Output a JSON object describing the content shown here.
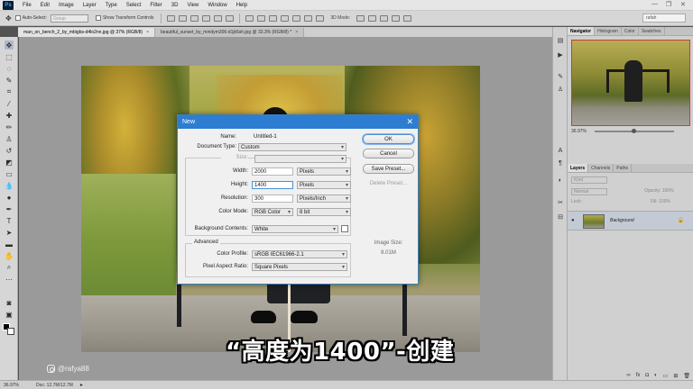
{
  "app": {
    "logo": "Ps",
    "menu": [
      "File",
      "Edit",
      "Image",
      "Layer",
      "Type",
      "Select",
      "Filter",
      "3D",
      "View",
      "Window",
      "Help"
    ],
    "window_controls": [
      "—",
      "❐",
      "✕"
    ]
  },
  "options_bar": {
    "auto_select_label": "Auto-Select:",
    "auto_select_value": "Group",
    "show_transform_label": "Show Transform Controls",
    "mode_3d_label": "3D Mode:",
    "search_value": "rafah"
  },
  "tabs": [
    {
      "label": "man_on_bench_2_by_mbigbs-d4lo2nn.jpg @ 37% (RGB/8)",
      "close": "×"
    },
    {
      "label": "beautiful_sunset_by_mindym306-d1jk6sh.jpg @ 33.3% (RGB/8) *",
      "close": "×"
    }
  ],
  "dialog": {
    "title": "New",
    "close": "✕",
    "name_label": "Name:",
    "name_value": "Untitled-1",
    "doc_type_label": "Document Type:",
    "doc_type_value": "Custom",
    "size_label": "Size:",
    "width_label": "Width:",
    "width_value": "2000",
    "width_unit": "Pixels",
    "height_label": "Height:",
    "height_value": "1400",
    "height_unit": "Pixels",
    "resolution_label": "Resolution:",
    "resolution_value": "300",
    "resolution_unit": "Pixels/Inch",
    "color_mode_label": "Color Mode:",
    "color_mode_value": "RGB Color",
    "bit_depth_value": "8 bit",
    "bg_contents_label": "Background Contents:",
    "bg_contents_value": "White",
    "advanced_label": "Advanced",
    "color_profile_label": "Color Profile:",
    "color_profile_value": "sRGB IEC61966-2.1",
    "pixel_aspect_label": "Pixel Aspect Ratio:",
    "pixel_aspect_value": "Square Pixels",
    "buttons": {
      "ok": "OK",
      "cancel": "Cancel",
      "save_preset": "Save Preset...",
      "delete_preset": "Delete Preset..."
    },
    "image_size_label": "Image Size:",
    "image_size_value": "8.01M"
  },
  "subtitle": "“高度为1400”-创建",
  "watermark": "@rafya88",
  "status_bar": {
    "zoom": "36.97%",
    "doc": "Doc: 12.7M/12.7M",
    "arrow": "▸"
  },
  "panels": {
    "top_tabs": [
      "Navigator",
      "Histogram",
      "Color",
      "Swatches"
    ],
    "navigator_zoom": "36.97%",
    "layer_tabs": [
      "Layers",
      "Channels",
      "Paths"
    ],
    "layer_kind": "Kind",
    "layer_blend": "Normal",
    "layer_opacity": "Opacity: 100%",
    "layer_fill": "Fill: 100%",
    "layer_lock": "Lock:",
    "layer_name": "Background"
  }
}
